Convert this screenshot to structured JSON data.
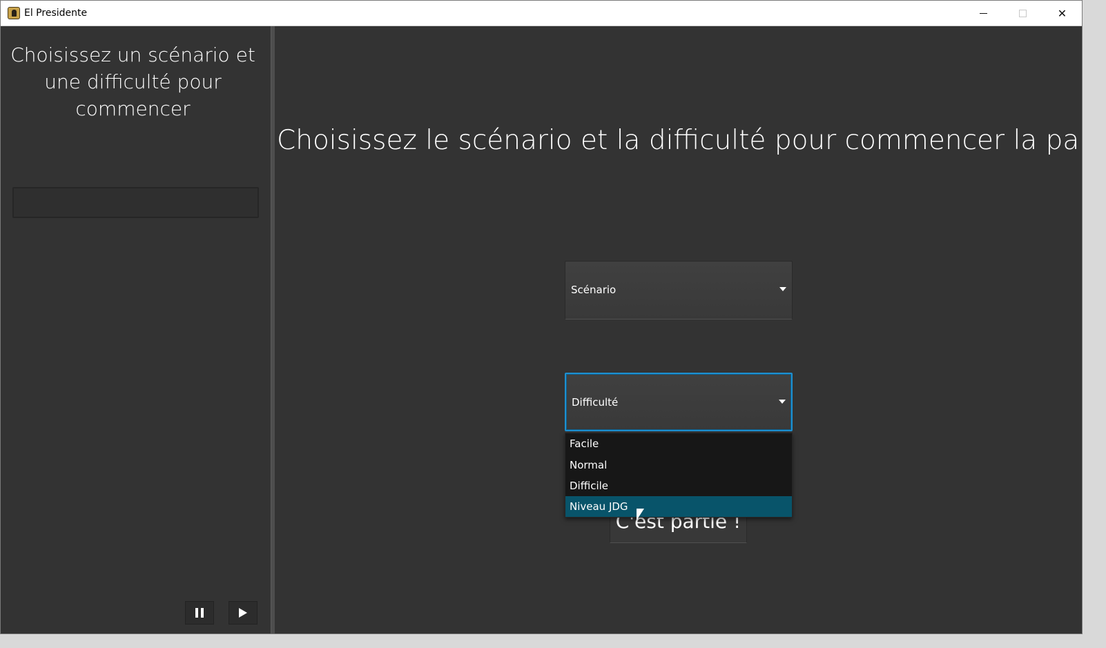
{
  "window": {
    "title": "El Presidente"
  },
  "left_panel": {
    "title": "Choisissez un scénario et une difficulté pour commencer",
    "text_field_value": ""
  },
  "main": {
    "title": "Choisissez le scénario et la difficulté pour commencer la partie",
    "scenario_combo": {
      "label": "Scénario"
    },
    "difficulty_combo": {
      "label": "Difficulté",
      "options": [
        "Facile",
        "Normal",
        "Difficile",
        "Niveau JDG"
      ],
      "highlighted": "Niveau JDG"
    },
    "start_button": {
      "label": "C'est partie !"
    }
  },
  "icons": {
    "app": "app-logo-icon",
    "minimize": "minimize-icon",
    "maximize": "maximize-icon",
    "close": "close-icon",
    "pause": "pause-icon",
    "play": "play-icon",
    "dropdown": "chevron-down-icon"
  },
  "colors": {
    "background": "#333333",
    "accent": "#1e90d0",
    "selected_option": "#08546a"
  }
}
